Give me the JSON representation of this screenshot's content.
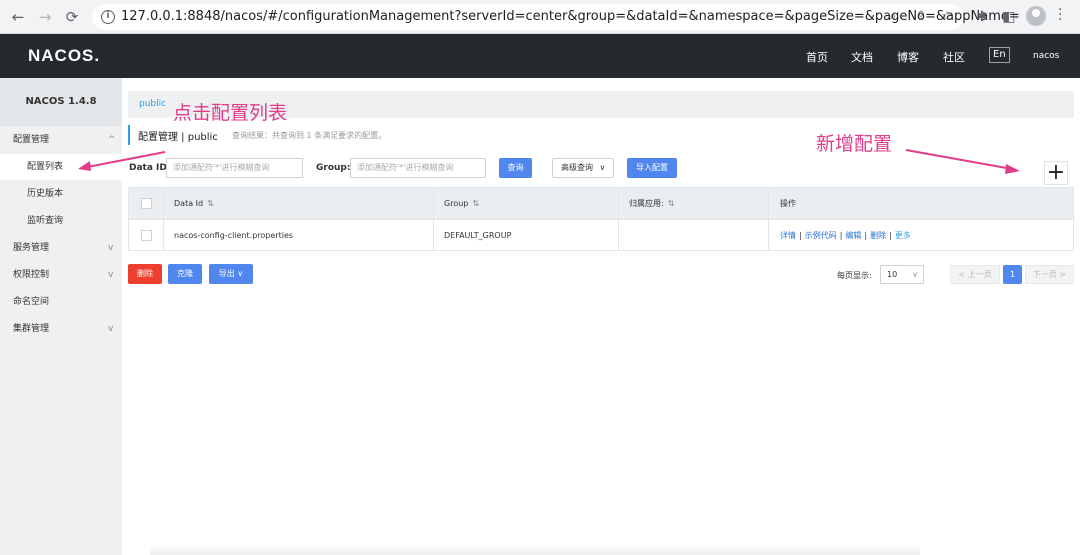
{
  "browser": {
    "url": "127.0.0.1:8848/nacos/#/configurationManagement?serverId=center&group=&dataId=&namespace=&pageSize=&pageNo=&appName=",
    "back_icon": "←",
    "forward_icon": "→",
    "reload_icon": "C"
  },
  "topnav": {
    "logo": "NACOS.",
    "items": [
      "首页",
      "文档",
      "博客",
      "社区"
    ],
    "lang": "En",
    "user": "nacos"
  },
  "sidebar": {
    "version": "NACOS 1.4.8",
    "items": [
      {
        "label": "配置管理",
        "chevron": "^"
      },
      {
        "label": "配置列表"
      },
      {
        "label": "历史版本"
      },
      {
        "label": "监听查询"
      },
      {
        "label": "服务管理",
        "chevron": "v"
      },
      {
        "label": "权限控制",
        "chevron": "v"
      },
      {
        "label": "命名空间"
      },
      {
        "label": "集群管理",
        "chevron": "v"
      }
    ]
  },
  "main": {
    "namespace_tab": "public",
    "title": "配置管理 | public",
    "result_text": "查询结果：共查询到 1 条满足要求的配置。",
    "filters": {
      "dataid_label": "Data ID:",
      "dataid_placeholder": "添加通配符'*'进行模糊查询",
      "group_label": "Group:",
      "group_placeholder": "添加通配符'*'进行模糊查询",
      "query_button": "查询",
      "advanced_button": "高级查询",
      "import_button": "导入配置"
    },
    "table": {
      "headers": [
        "Data Id",
        "Group",
        "归属应用:",
        "操作"
      ],
      "rows": [
        {
          "data_id": "nacos-config-client.properties",
          "group": "DEFAULT_GROUP",
          "app": "",
          "ops": [
            "详情",
            "示例代码",
            "编辑",
            "删除",
            "更多"
          ]
        }
      ]
    },
    "footer": {
      "delete_button": "删除",
      "clone_button": "克隆",
      "export_button": "导出",
      "page_size_label": "每页显示:",
      "page_size": "10",
      "prev": "< 上一页",
      "current_page": "1",
      "next": "下一页 >"
    }
  },
  "annotations": {
    "config_list": "点击配置列表",
    "add_config": "新增配置"
  },
  "colors": {
    "accent": "#4f87ee",
    "danger": "#ee3f2e",
    "annotation": "#e33c8c",
    "topnav": "#252a2f"
  }
}
